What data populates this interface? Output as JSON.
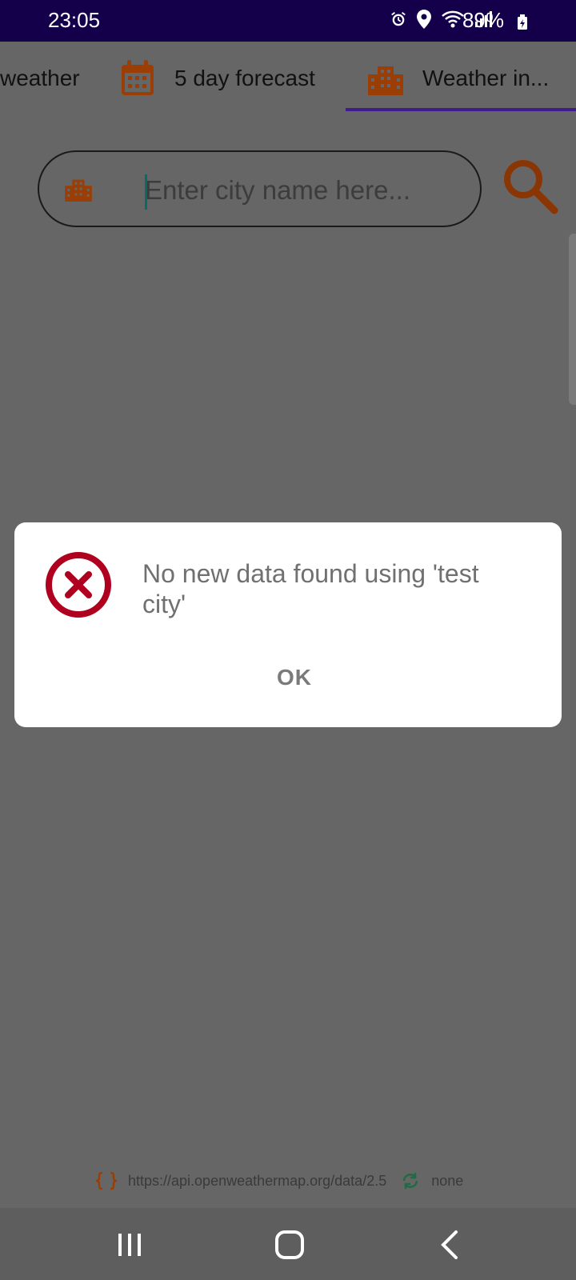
{
  "status_bar": {
    "time": "23:05",
    "battery": "89%",
    "icons": [
      "alarm-icon",
      "location-icon",
      "wifi-icon",
      "signal-icon",
      "battery-icon"
    ]
  },
  "tabs": [
    {
      "label": "weather",
      "icon": "weather-icon",
      "selected": false
    },
    {
      "label": "5 day forecast",
      "icon": "calendar-icon",
      "selected": false
    },
    {
      "label": "Weather in...",
      "icon": "building-icon",
      "selected": true
    }
  ],
  "search": {
    "placeholder": "Enter city name here...",
    "value": ""
  },
  "dialog": {
    "message": "No new data found using 'test city'",
    "ok_label": "OK",
    "icon": "error-icon"
  },
  "footer": {
    "api_url": "https://api.openweathermap.org/data/2.5",
    "sync_status": "none"
  },
  "colors": {
    "accent": "#9a3e05",
    "status_bar": "#14004a",
    "tab_indicator": "#3f1c8c",
    "error": "#b0001f",
    "cursor": "#0b6b63"
  },
  "nav": [
    "recent-apps-button",
    "home-button",
    "back-button"
  ]
}
